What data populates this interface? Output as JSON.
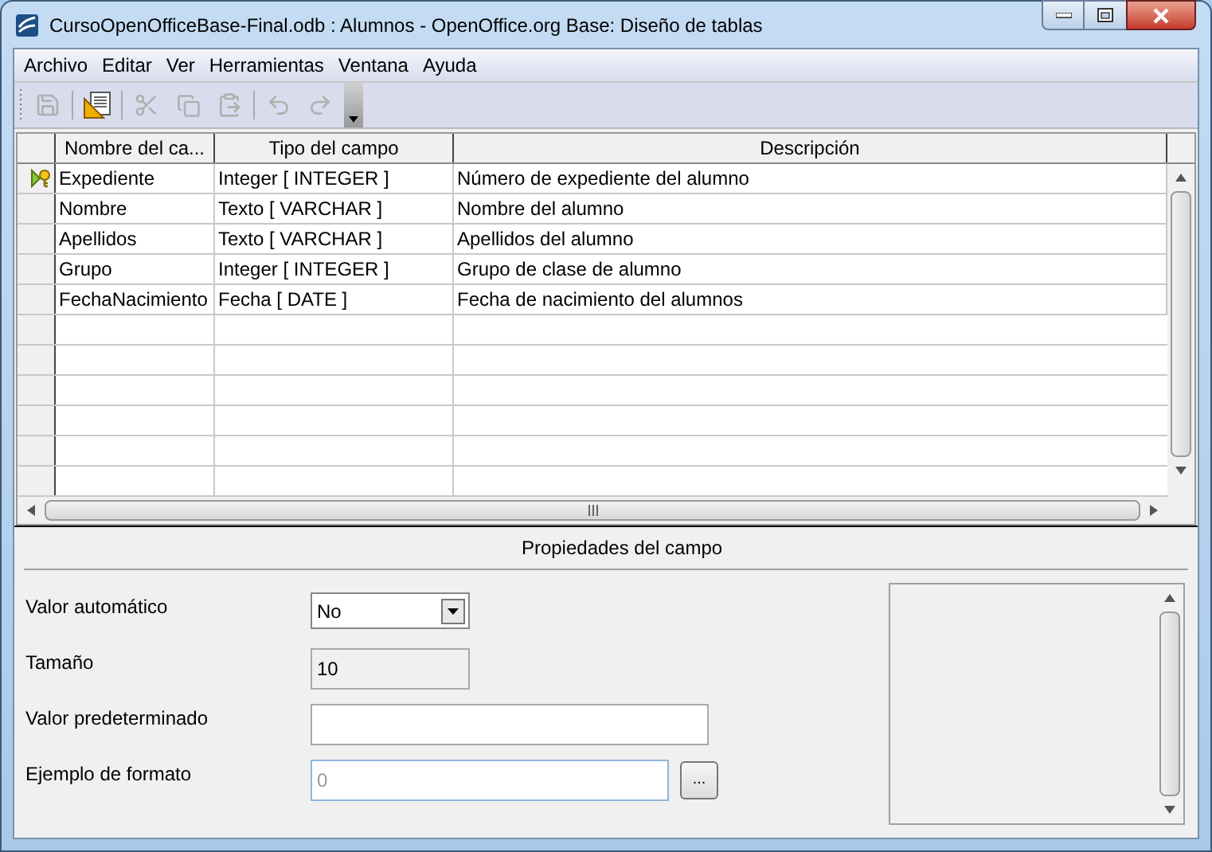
{
  "window": {
    "title": "CursoOpenOfficeBase-Final.odb : Alumnos - OpenOffice.org Base: Diseño de tablas"
  },
  "menu": [
    "Archivo",
    "Editar",
    "Ver",
    "Herramientas",
    "Ventana",
    "Ayuda"
  ],
  "toolbar": [
    {
      "kind": "save",
      "disabled": true
    },
    {
      "kind": "edit",
      "disabled": false
    },
    {
      "kind": "cut",
      "disabled": true
    },
    {
      "kind": "copy",
      "disabled": true
    },
    {
      "kind": "paste",
      "disabled": true
    },
    {
      "kind": "undo",
      "disabled": true
    },
    {
      "kind": "redo",
      "disabled": true
    }
  ],
  "table": {
    "columns": [
      "Nombre del ca...",
      "Tipo del campo",
      "Descripción"
    ],
    "rows": [
      {
        "primary_key": true,
        "cells": [
          "Expediente",
          "Integer [ INTEGER ]",
          "Número de expediente del alumno"
        ]
      },
      {
        "primary_key": false,
        "cells": [
          "Nombre",
          "Texto [ VARCHAR ]",
          "Nombre del alumno"
        ]
      },
      {
        "primary_key": false,
        "cells": [
          "Apellidos",
          "Texto [ VARCHAR ]",
          "Apellidos del alumno"
        ]
      },
      {
        "primary_key": false,
        "cells": [
          "Grupo",
          "Integer [ INTEGER ]",
          "Grupo de clase de alumno"
        ]
      },
      {
        "primary_key": false,
        "cells": [
          "FechaNacimiento",
          "Fecha [ DATE ]",
          "Fecha de nacimiento del alumnos"
        ]
      }
    ]
  },
  "properties": {
    "title": "Propiedades del campo",
    "fields": [
      {
        "kind": "select",
        "label": "Valor automático",
        "value": "No"
      },
      {
        "kind": "text",
        "label": "Tamaño",
        "value": "10",
        "disabled": true
      },
      {
        "kind": "text",
        "label": "Valor predeterminado",
        "disabled": false
      },
      {
        "kind": "format",
        "label": "Ejemplo de formato",
        "placeholder": "0",
        "button": "..."
      }
    ]
  }
}
